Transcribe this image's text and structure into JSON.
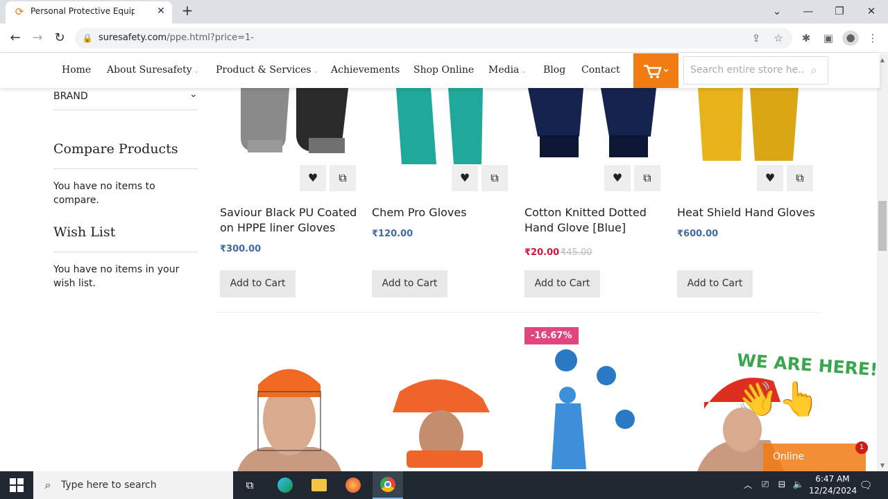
{
  "browser": {
    "tab_title": "Personal Protective Equipment |",
    "url_domain": "suresafety.com",
    "url_path": "/ppe.html?price=1-"
  },
  "nav": {
    "items": [
      "Home",
      "About Suresafety",
      "Product & Services",
      "Achievements",
      "Shop Online",
      "Media",
      "Blog",
      "Contact"
    ],
    "search_placeholder": "Search entire store he..."
  },
  "sidebar": {
    "brand": "BRAND",
    "compare_title": "Compare Products",
    "compare_text": "You have no items to compare.",
    "wish_title": "Wish List",
    "wish_text": "You have no items in your wish list."
  },
  "products": [
    {
      "name": "Saviour Black PU Coated on HPPE liner Gloves",
      "price": "₹300.00",
      "button": "Add to Cart"
    },
    {
      "name": "Chem Pro Gloves",
      "price": "₹120.00",
      "button": "Add to Cart"
    },
    {
      "name": "Cotton Knitted Dotted Hand Glove [Blue]",
      "price": "₹20.00",
      "old_price": "₹45.00",
      "button": "Add to Cart"
    },
    {
      "name": "Heat Shield Hand Gloves",
      "price": "₹600.00",
      "button": "Add to Cart"
    }
  ],
  "row2": {
    "discount_badge": "-16.67%"
  },
  "chat": {
    "banner": "WE ARE HERE!",
    "status": "Online",
    "count": "1"
  },
  "taskbar": {
    "search_placeholder": "Type here to search",
    "time": "6:47 AM",
    "date": "12/24/2024"
  },
  "colors": {
    "accent": "#f07c12",
    "price": "#3f6aa3",
    "sale": "#d0163b",
    "badge": "#e0457b"
  }
}
